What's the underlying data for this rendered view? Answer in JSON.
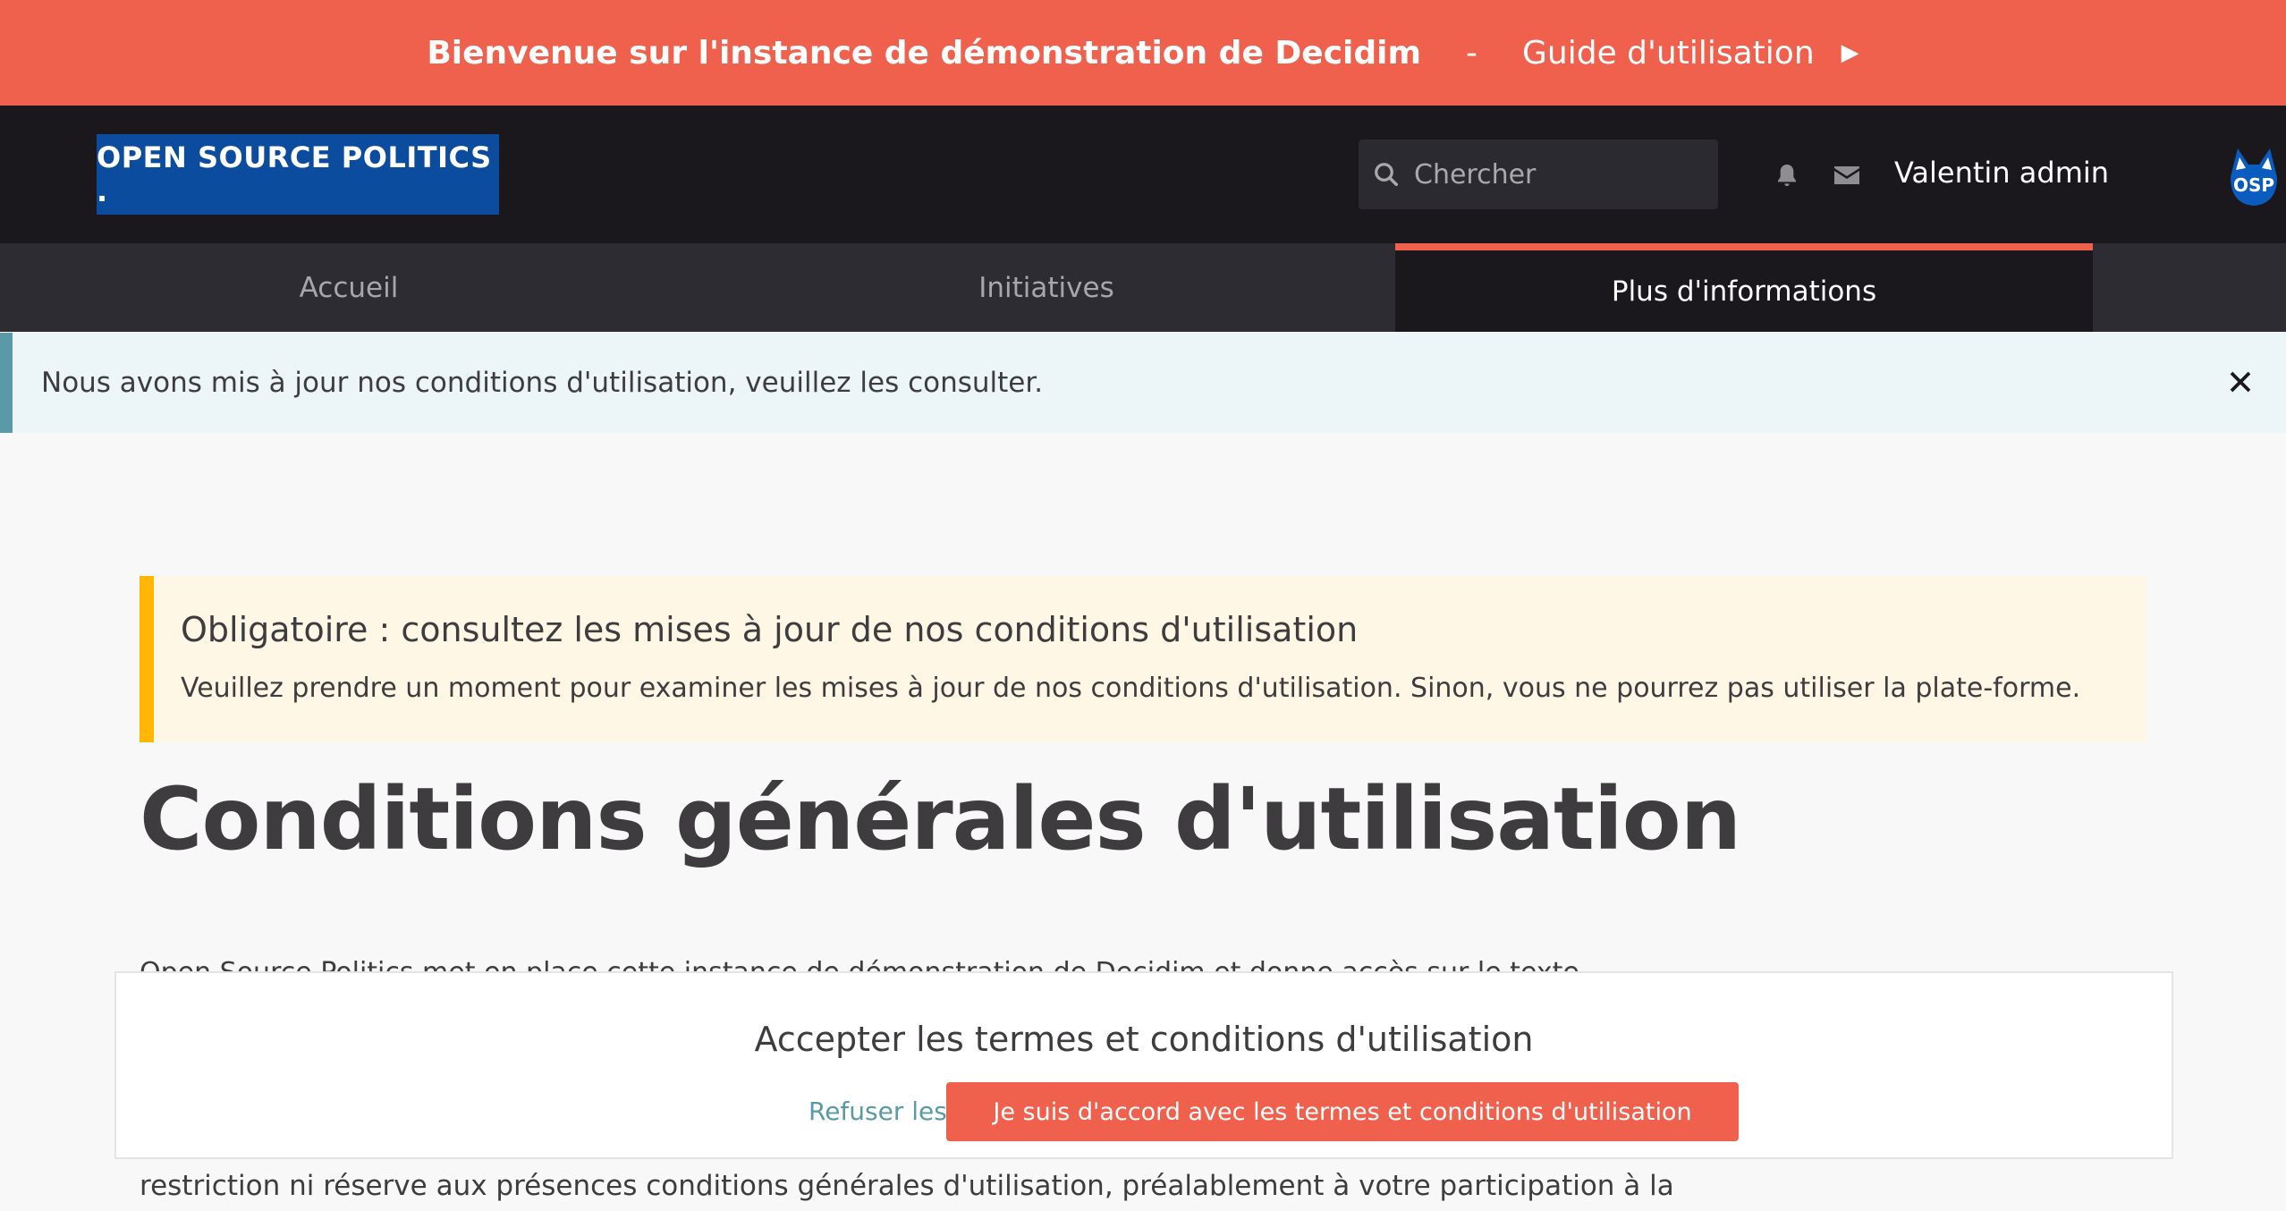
{
  "announcement": {
    "welcome": "Bienvenue sur l'instance de démonstration de Decidim",
    "separator": "-",
    "guide_link": "Guide d'utilisation"
  },
  "header": {
    "logo_text": "OPEN SOURCE POLITICS .",
    "search_placeholder": "Chercher",
    "username": "Valentin admin",
    "badge_text": "OSP"
  },
  "nav": {
    "tabs": [
      {
        "label": "Accueil"
      },
      {
        "label": "Initiatives"
      },
      {
        "label": "Plus d'informations",
        "active": true
      }
    ]
  },
  "callout": {
    "message": "Nous avons mis à jour nos conditions d'utilisation, veuillez les consulter."
  },
  "warning": {
    "title": "Obligatoire : consultez les mises à jour de nos conditions d'utilisation",
    "text": "Veuillez prendre un moment pour examiner les mises à jour de nos conditions d'utilisation. Sinon, vous ne pourrez pas utiliser la plate-forme."
  },
  "page": {
    "title": "Conditions générales d'utilisation",
    "partial_line": "Open Source Politics met en place cette instance de démonstration de Decidim et donne accès sur le texte",
    "body_line": "restriction ni réserve aux présences conditions générales d'utilisation, préalablement à votre participation à la"
  },
  "accept_panel": {
    "title": "Accepter les termes et conditions d'utilisation",
    "refuse_label": "Refuser les termes",
    "agree_label": "Je suis d'accord avec les termes et conditions d'utilisation"
  },
  "colors": {
    "brand": "#ef604d",
    "header_bg": "#1a181d",
    "logo_bg": "#0b4c9e",
    "warning_accent": "#ffb703",
    "info_accent": "#599aa6"
  }
}
